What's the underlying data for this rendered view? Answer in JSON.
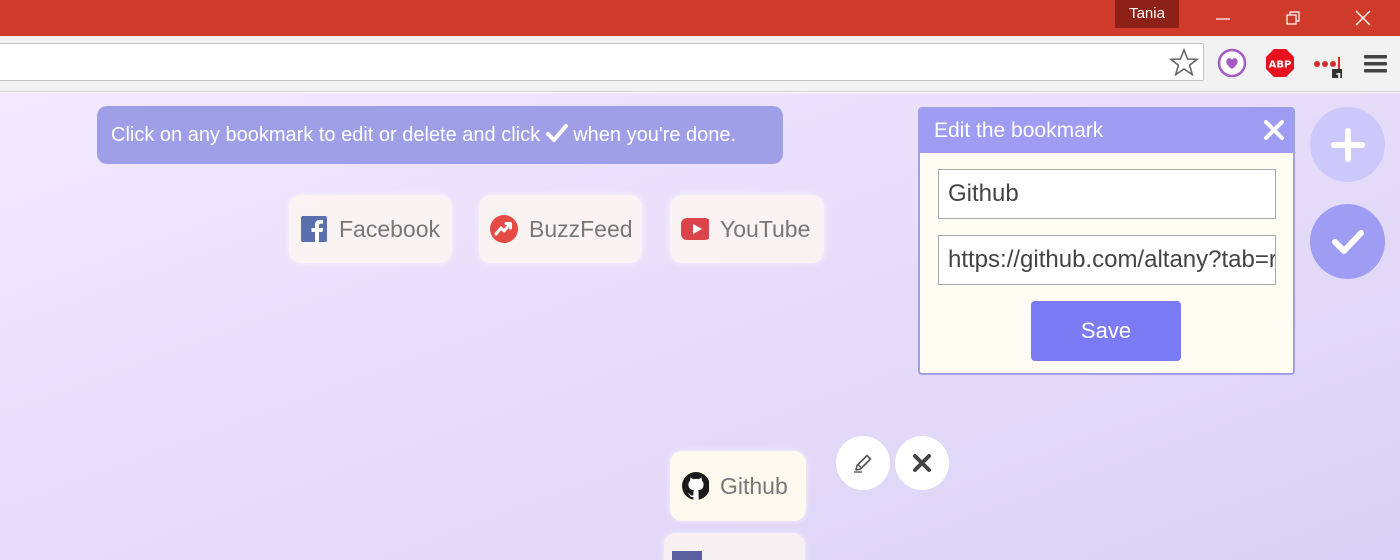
{
  "window": {
    "profile_name": "Tania"
  },
  "page": {
    "hint": {
      "text_before": "Click on any bookmark to edit or delete and click",
      "text_after": "when you're done."
    },
    "bookmarks": [
      {
        "label": "Facebook",
        "icon": "facebook-icon",
        "color": "#5b6fae"
      },
      {
        "label": "BuzzFeed",
        "icon": "buzzfeed-icon",
        "color": "#e54b45"
      },
      {
        "label": "YouTube",
        "icon": "youtube-icon",
        "color": "#d9454a"
      },
      {
        "label": "Github",
        "icon": "github-icon",
        "color": "#1b1b1b"
      }
    ],
    "edit_panel": {
      "title": "Edit the bookmark",
      "name_value": "Github",
      "url_value": "https://github.com/altany?tab=repositories",
      "save_label": "Save"
    }
  },
  "colors": {
    "titlebar": "#cf3a2a",
    "accent": "#9f9fe8",
    "save_button": "#7b7cf5"
  }
}
